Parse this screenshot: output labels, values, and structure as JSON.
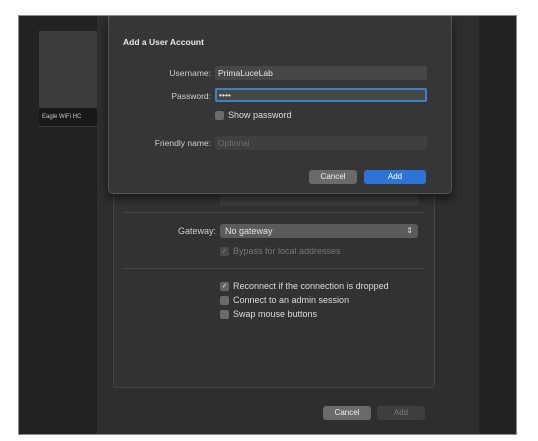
{
  "background": {
    "tile_label": "Eagle WiFi HC"
  },
  "connection": {
    "gateway_label": "Gateway:",
    "gateway_value": "No gateway",
    "bypass_label": "Bypass for local addresses",
    "options": [
      {
        "label": "Reconnect if the connection is dropped",
        "checked": true
      },
      {
        "label": "Connect to an admin session",
        "checked": false
      },
      {
        "label": "Swap mouse buttons",
        "checked": false
      }
    ],
    "cancel_label": "Cancel",
    "add_label": "Add"
  },
  "dialog": {
    "title": "Add a User Account",
    "username_label": "Username:",
    "username_value": "PrimaLuceLab",
    "password_label": "Password:",
    "password_value": "••••",
    "show_password_label": "Show password",
    "friendly_label": "Friendly name:",
    "friendly_placeholder": "Optional",
    "cancel_label": "Cancel",
    "add_label": "Add"
  },
  "colors": {
    "accent": "#2d74d6",
    "focus_ring": "#3b82c6"
  }
}
